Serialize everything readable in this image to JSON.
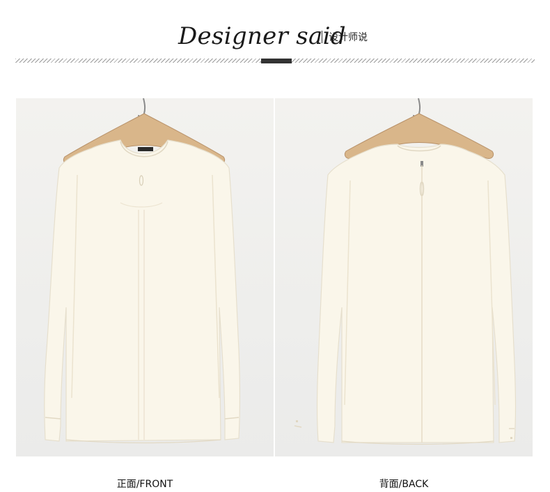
{
  "header": {
    "title_en": "Designer said",
    "title_cn": "设计师说"
  },
  "photos": [
    {
      "view": "front",
      "caption": "正面/FRONT"
    },
    {
      "view": "back",
      "caption": "背面/BACK"
    }
  ],
  "colors": {
    "garment": "#faf6ea",
    "hanger": "#d9b68a",
    "background": "#efefed"
  }
}
